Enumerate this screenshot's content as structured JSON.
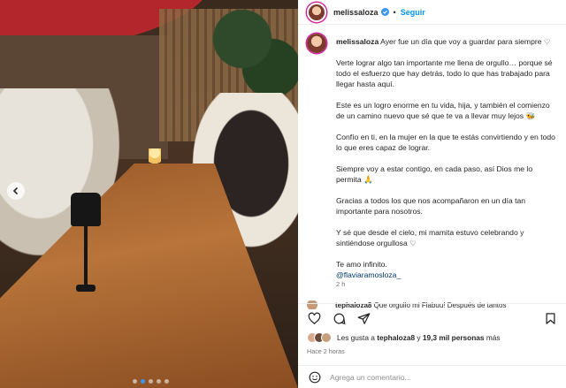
{
  "post": {
    "username": "melissaloza",
    "follow_label": "Seguir",
    "separator": "•"
  },
  "caption": {
    "username": "melissaloza",
    "paragraphs": [
      "Ayer fue un día que voy a guardar para siempre ♡",
      "Verte lograr algo tan importante me llena de orgullo… porque sé todo el esfuerzo que hay detrás, todo lo que has trabajado para llegar hasta aquí.",
      "Este es un logro enorme en tu vida, hija, y también el comienzo de un camino nuevo que sé que te va a llevar muy lejos 🐝",
      "Confío en ti, en la mujer en la que te estás convirtiendo y en todo lo que eres capaz de lograr.",
      "Siempre voy a estar contigo, en cada paso, así Dios me lo permita 🙏",
      "Gracias a todos los que nos acompañaron en un día tan importante para nosotros.",
      "Y sé que desde el cielo, mi mamita estuvo celebrando y sintiéndose orgullosa ♡",
      "Te amo infinito."
    ],
    "mention": "@flaviaramosloza_",
    "time": "2 h"
  },
  "comment_preview": {
    "username": "tephaloza8",
    "text": "Que orgullo mi Flabuu! Después de tantos"
  },
  "likes": {
    "prefix": "Les gusta a",
    "user": "tephaloza8",
    "connector": "y",
    "count": "19,3 mil personas",
    "suffix": "más",
    "ago": "Hace 2 horas"
  },
  "add_comment": {
    "placeholder": "Agrega un comentario..."
  },
  "carousel": {
    "total": 5,
    "current": 2
  },
  "colors": {
    "accent": "#0095f6",
    "mention": "#00376b",
    "muted": "#737373",
    "story_ring": "#d6249f"
  }
}
